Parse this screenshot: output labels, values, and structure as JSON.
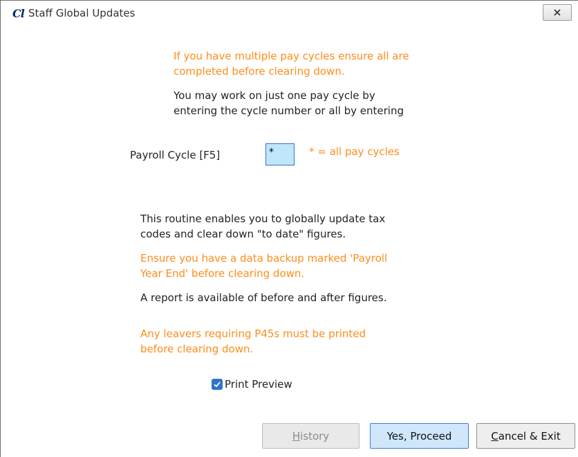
{
  "window": {
    "logo_text": "Cl",
    "title": "Staff Global Updates",
    "close_icon": "close-icon"
  },
  "message": {
    "pay_cycles_warning_line1": "If you have multiple pay cycles ensure all are",
    "pay_cycles_warning_line2": "completed before clearing down.",
    "cycle_info_line1": "You may work on just one pay cycle by",
    "cycle_info_line2": "entering the cycle number or all by entering"
  },
  "payroll_cycle": {
    "label": "Payroll Cycle [F5]",
    "value": "*",
    "hint": "* = all pay cycles"
  },
  "info": {
    "routine_line1": "This routine enables you to globally update tax",
    "routine_line2": "codes and clear down \"to date\" figures.",
    "backup_line1": "Ensure you have a data backup marked 'Payroll",
    "backup_line2": "Year End' before clearing down.",
    "report": "A report is available of before and after figures.",
    "leavers_line1": "Any leavers requiring P45s must be printed",
    "leavers_line2": "before clearing down."
  },
  "print_preview": {
    "label": "Print Preview",
    "checked": true
  },
  "buttons": {
    "history_prefix": "H",
    "history_rest": "istory",
    "proceed": "Yes, Proceed",
    "cancel_prefix": "C",
    "cancel_rest": "ancel & Exit"
  },
  "colors": {
    "warning": "#ff8c1a",
    "input_bg": "#bfe6fb",
    "accent": "#2f73c9"
  }
}
